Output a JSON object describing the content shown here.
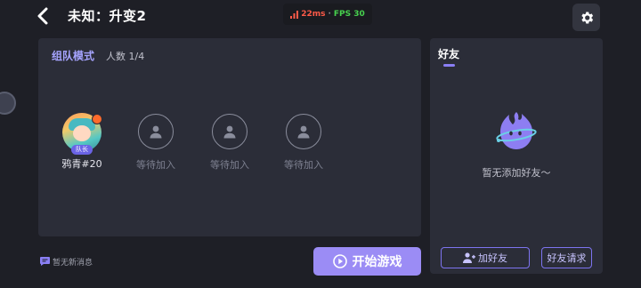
{
  "header": {
    "title": "未知：升变2",
    "ping": "22ms",
    "separator": "·",
    "fps": "FPS 30"
  },
  "team": {
    "title": "组队模式",
    "count": "人数 1/4",
    "host_badge": "队长",
    "slots": [
      {
        "label": "鸦青#20"
      },
      {
        "label": "等待加入"
      },
      {
        "label": "等待加入"
      },
      {
        "label": "等待加入"
      }
    ]
  },
  "friends": {
    "title": "好友",
    "empty_text": "暂无添加好友～",
    "add_friend_label": "加好友",
    "requests_label": "好友请求"
  },
  "footer": {
    "message_text": "暂无新消息",
    "start_label": "开始游戏"
  },
  "icons": [
    "back-arrow-icon",
    "signal-icon",
    "gear-icon",
    "person-icon",
    "mascot-icon",
    "add-person-icon",
    "chat-icon",
    "play-icon"
  ],
  "colors": {
    "background": "#1e1f26",
    "panel": "#2b2d38",
    "accent": "#9b8cf5",
    "ping": "#ff5a48",
    "fps": "#47d14e"
  }
}
